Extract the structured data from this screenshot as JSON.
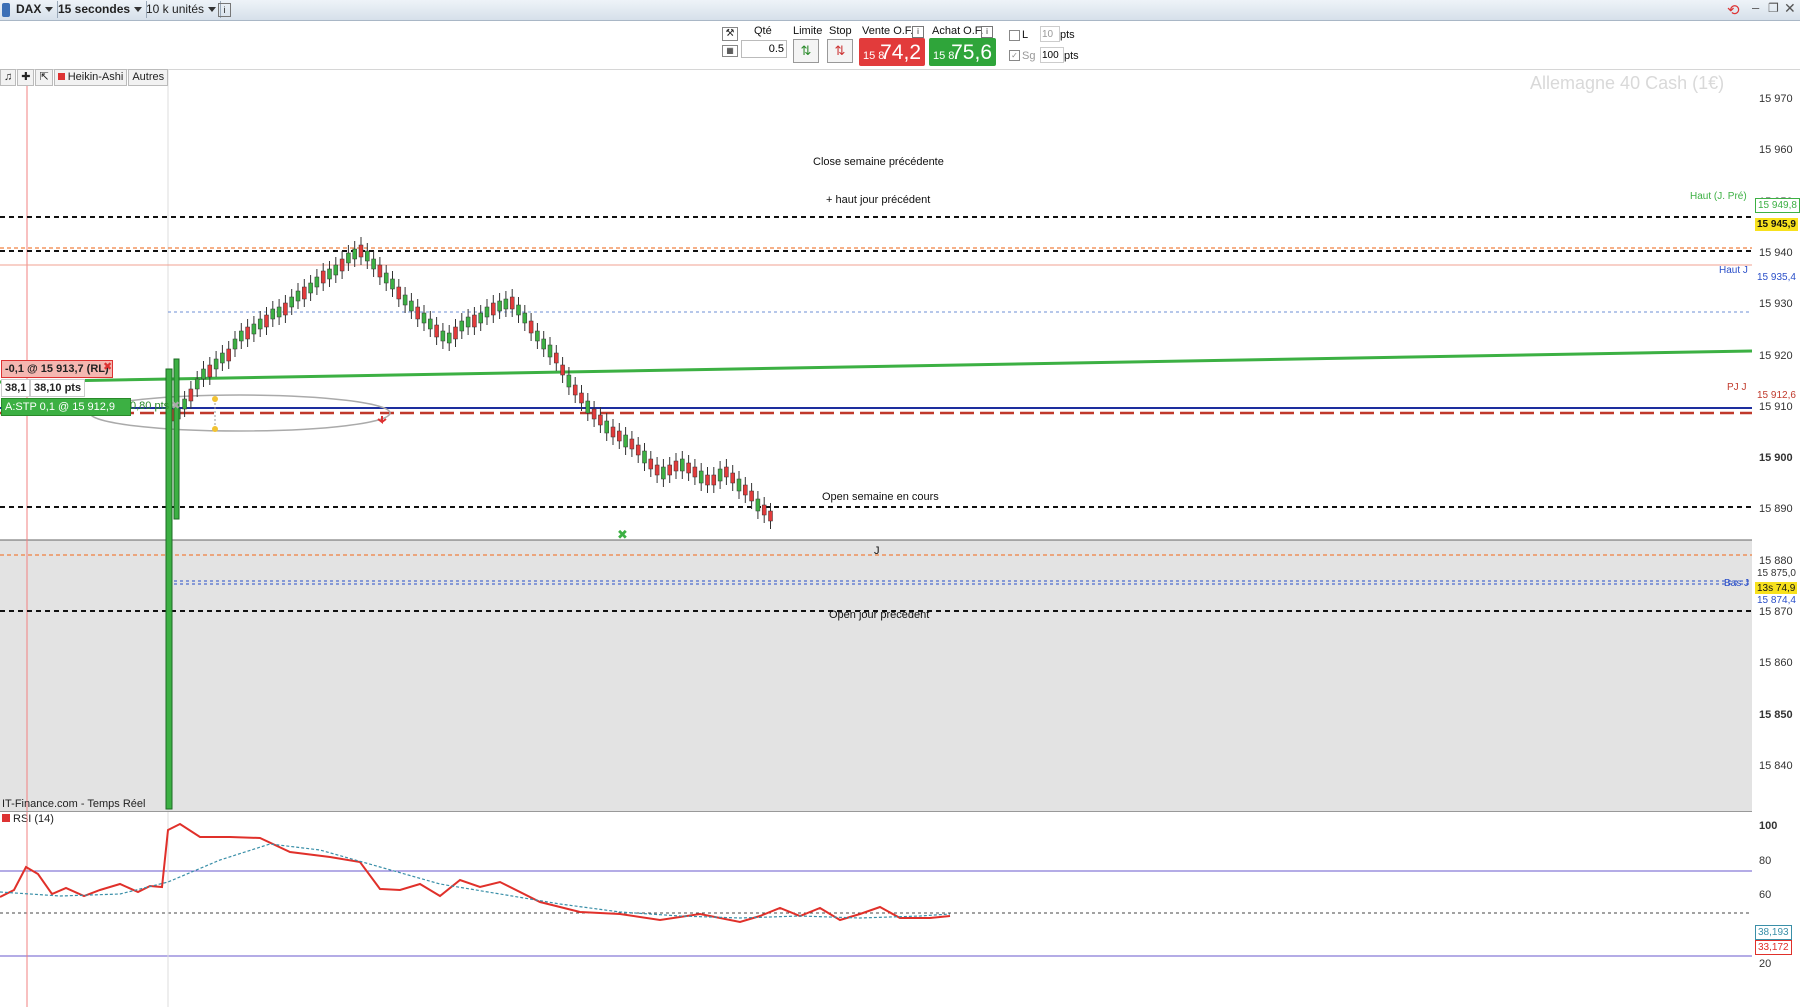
{
  "toolbar": {
    "instrument": "DAX",
    "timeframe": "15 secondes",
    "units": "10 k unités"
  },
  "order_panel": {
    "qty_label": "Qté",
    "qty_value": "0.5",
    "limit_label": "Limite",
    "stop_label": "Stop",
    "sell_label": "Vente O.F.",
    "buy_label": "Achat O.F.",
    "sell_prefix": "15 8",
    "sell_price": "74,2",
    "buy_prefix": "15 8",
    "buy_price": "75,6",
    "l_label": "L",
    "l_value": "10",
    "pts_label": "pts",
    "sg_label": "Sg",
    "sg_value": "100",
    "pts_label2": "pts",
    "sell_color": "#e23b3b",
    "buy_color": "#2fa53a"
  },
  "chart_toolbar": {
    "style": "Heikin-Ashi",
    "others": "Autres"
  },
  "watermark": "Allemagne 40 Cash (1€)",
  "source": "IT-Finance.com - Temps Réel",
  "levels": {
    "close_prev_week": "Close semaine précédente",
    "high_prev_day": "+ haut jour précédent",
    "high_prev_day_right": "Haut (J. Pré)",
    "high_day": "Haut J",
    "open_week": "Open semaine en cours",
    "j_mark": "J",
    "open_prev_day": "Open jour précédent",
    "bas_j": "Bas J",
    "pj": "PJ J"
  },
  "orders": {
    "limit_order": "-0,1 @ 15 913,7 (RL)",
    "pos_size": "38,1",
    "pos_pts": "38,10 pts",
    "stop_order": "A:STP 0,1 @ 15 912,9",
    "stop_pts": "0,80 pts"
  },
  "y_axis": {
    "ticks": [
      "15 970",
      "15 960",
      "15 950",
      "15 940",
      "15 930",
      "15 920",
      "15 910",
      "15 900",
      "15 890",
      "15 880",
      "15 870",
      "15 860",
      "15 850",
      "15 840"
    ],
    "tags": {
      "high_prev": "15 949,8",
      "yellow": "15 945,9",
      "high_day": "15 935,4",
      "red": "15 912,6",
      "gray": "15 875,0",
      "current": "13s 74,9",
      "low": "15 874,4"
    }
  },
  "rsi": {
    "label": "RSI (14)",
    "ticks": [
      "100",
      "80",
      "60",
      "20"
    ],
    "tag1": "38,193",
    "tag2": "33,172"
  }
}
